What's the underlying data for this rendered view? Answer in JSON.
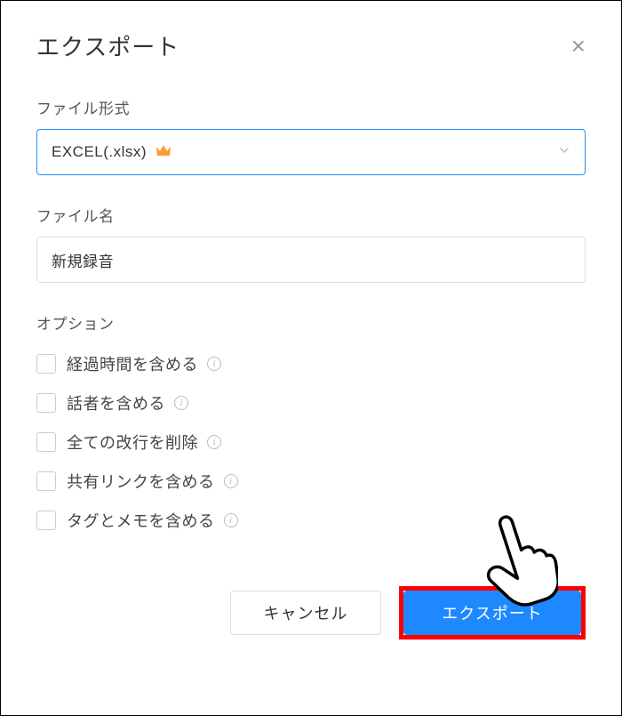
{
  "header": {
    "title": "エクスポート",
    "close": "×"
  },
  "file_format": {
    "label": "ファイル形式",
    "selected": "EXCEL(.xlsx)"
  },
  "file_name": {
    "label": "ファイル名",
    "value": "新規録音"
  },
  "options": {
    "label": "オプション",
    "items": [
      {
        "label": "経過時間を含める",
        "checked": false
      },
      {
        "label": "話者を含める",
        "checked": false
      },
      {
        "label": "全ての改行を削除",
        "checked": false
      },
      {
        "label": "共有リンクを含める",
        "checked": false
      },
      {
        "label": "タグとメモを含める",
        "checked": false
      }
    ]
  },
  "footer": {
    "cancel": "キャンセル",
    "export": "エクスポート"
  }
}
